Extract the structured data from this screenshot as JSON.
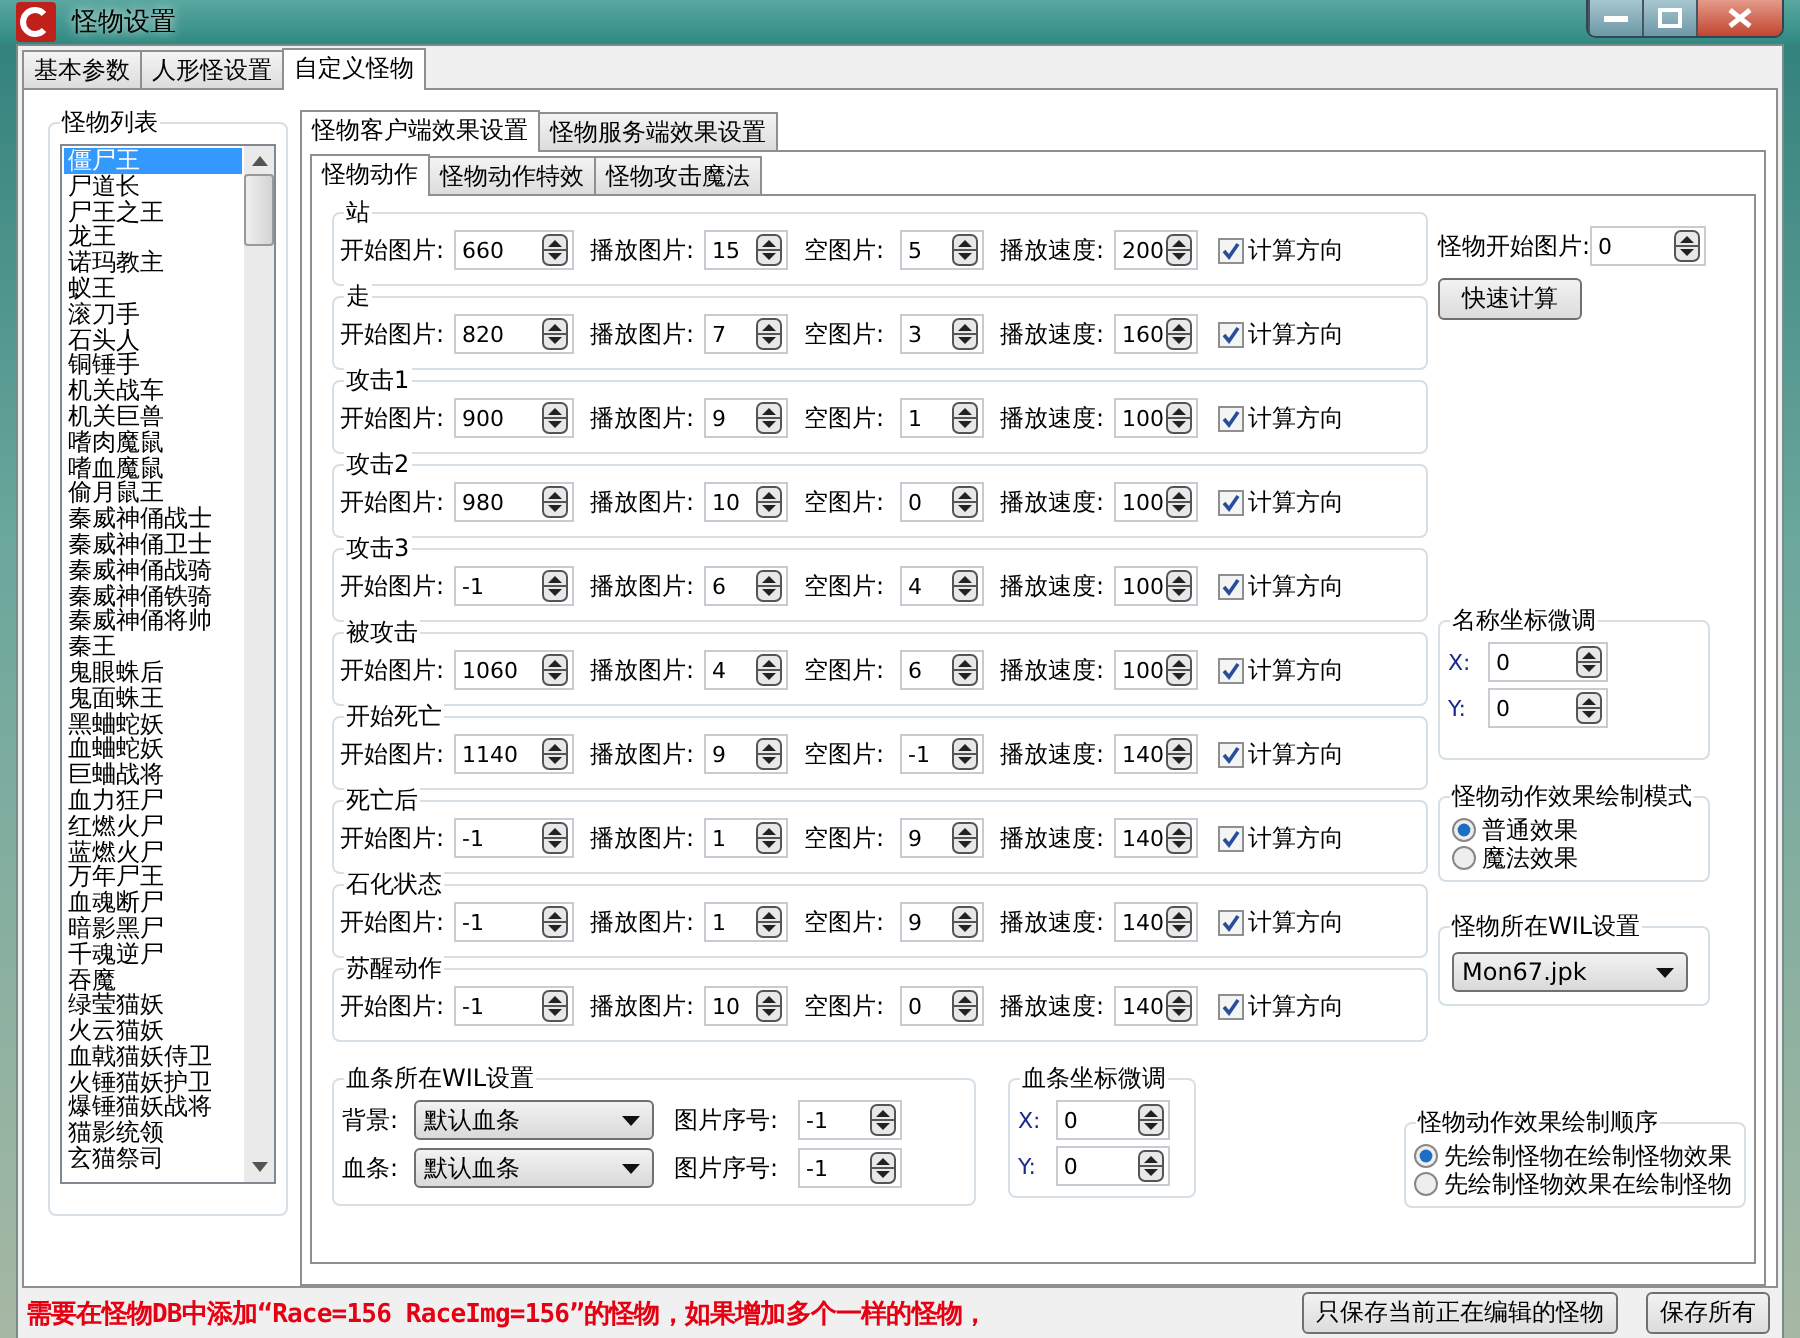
{
  "window": {
    "title": "怪物设置"
  },
  "tabs": [
    {
      "label": "基本参数",
      "selected": false
    },
    {
      "label": "人形怪设置",
      "selected": false
    },
    {
      "label": "自定义怪物",
      "selected": true
    }
  ],
  "monster_list": {
    "title": "怪物列表",
    "items": [
      {
        "label": "僵尸王",
        "selected": true
      },
      {
        "label": "尸道长",
        "selected": false
      },
      {
        "label": "尸王之王",
        "selected": false
      },
      {
        "label": "龙王",
        "selected": false
      },
      {
        "label": "诺玛教主",
        "selected": false
      },
      {
        "label": "蚁王",
        "selected": false
      },
      {
        "label": "滚刀手",
        "selected": false
      },
      {
        "label": "石头人",
        "selected": false
      },
      {
        "label": "铜锤手",
        "selected": false
      },
      {
        "label": "机关战车",
        "selected": false
      },
      {
        "label": "机关巨兽",
        "selected": false
      },
      {
        "label": "嗜肉魔鼠",
        "selected": false
      },
      {
        "label": "嗜血魔鼠",
        "selected": false
      },
      {
        "label": "偷月鼠王",
        "selected": false
      },
      {
        "label": "秦威神俑战士",
        "selected": false
      },
      {
        "label": "秦威神俑卫士",
        "selected": false
      },
      {
        "label": "秦威神俑战骑",
        "selected": false
      },
      {
        "label": "秦威神俑铁骑",
        "selected": false
      },
      {
        "label": "秦威神俑将帅",
        "selected": false
      },
      {
        "label": "秦王",
        "selected": false
      },
      {
        "label": "鬼眼蛛后",
        "selected": false
      },
      {
        "label": "鬼面蛛王",
        "selected": false
      },
      {
        "label": "黑蛐蛇妖",
        "selected": false
      },
      {
        "label": "血蛐蛇妖",
        "selected": false
      },
      {
        "label": "巨蛐战将",
        "selected": false
      },
      {
        "label": "血力狂尸",
        "selected": false
      },
      {
        "label": "红燃火尸",
        "selected": false
      },
      {
        "label": "蓝燃火尸",
        "selected": false
      },
      {
        "label": "万年尸王",
        "selected": false
      },
      {
        "label": "血魂断尸",
        "selected": false
      },
      {
        "label": "暗影黑尸",
        "selected": false
      },
      {
        "label": "千魂逆尸",
        "selected": false
      },
      {
        "label": "吞魔",
        "selected": false
      },
      {
        "label": "绿莹猫妖",
        "selected": false
      },
      {
        "label": "火云猫妖",
        "selected": false
      },
      {
        "label": "血戟猫妖侍卫",
        "selected": false
      },
      {
        "label": "火锤猫妖护卫",
        "selected": false
      },
      {
        "label": "爆锤猫妖战将",
        "selected": false
      },
      {
        "label": "猫影统领",
        "selected": false
      },
      {
        "label": "玄猫祭司",
        "selected": false
      }
    ]
  },
  "sub_tabs": [
    {
      "label": "怪物客户端效果设置",
      "selected": true
    },
    {
      "label": "怪物服务端效果设置",
      "selected": false
    }
  ],
  "action_tabs": [
    {
      "label": "怪物动作",
      "selected": true
    },
    {
      "label": "怪物动作特效",
      "selected": false
    },
    {
      "label": "怪物攻击魔法",
      "selected": false
    }
  ],
  "actions": [
    {
      "title": "站",
      "fields": [
        {
          "label": "开始图片:",
          "value": "660"
        },
        {
          "label": "播放图片:",
          "value": "15"
        },
        {
          "label": "空图片:",
          "value": "5"
        },
        {
          "label": "播放速度:",
          "value": "200"
        }
      ],
      "direction": {
        "label": "计算方向",
        "checked": true
      }
    },
    {
      "title": "走",
      "fields": [
        {
          "label": "开始图片:",
          "value": "820"
        },
        {
          "label": "播放图片:",
          "value": "7"
        },
        {
          "label": "空图片:",
          "value": "3"
        },
        {
          "label": "播放速度:",
          "value": "160"
        }
      ],
      "direction": {
        "label": "计算方向",
        "checked": true
      }
    },
    {
      "title": "攻击1",
      "fields": [
        {
          "label": "开始图片:",
          "value": "900"
        },
        {
          "label": "播放图片:",
          "value": "9"
        },
        {
          "label": "空图片:",
          "value": "1"
        },
        {
          "label": "播放速度:",
          "value": "100"
        }
      ],
      "direction": {
        "label": "计算方向",
        "checked": true
      }
    },
    {
      "title": "攻击2",
      "fields": [
        {
          "label": "开始图片:",
          "value": "980"
        },
        {
          "label": "播放图片:",
          "value": "10"
        },
        {
          "label": "空图片:",
          "value": "0"
        },
        {
          "label": "播放速度:",
          "value": "100"
        }
      ],
      "direction": {
        "label": "计算方向",
        "checked": true
      }
    },
    {
      "title": "攻击3",
      "fields": [
        {
          "label": "开始图片:",
          "value": "-1"
        },
        {
          "label": "播放图片:",
          "value": "6"
        },
        {
          "label": "空图片:",
          "value": "4"
        },
        {
          "label": "播放速度:",
          "value": "100"
        }
      ],
      "direction": {
        "label": "计算方向",
        "checked": true
      }
    },
    {
      "title": "被攻击",
      "fields": [
        {
          "label": "开始图片:",
          "value": "1060"
        },
        {
          "label": "播放图片:",
          "value": "4"
        },
        {
          "label": "空图片:",
          "value": "6"
        },
        {
          "label": "播放速度:",
          "value": "100"
        }
      ],
      "direction": {
        "label": "计算方向",
        "checked": true
      }
    },
    {
      "title": "开始死亡",
      "fields": [
        {
          "label": "开始图片:",
          "value": "1140"
        },
        {
          "label": "播放图片:",
          "value": "9"
        },
        {
          "label": "空图片:",
          "value": "-1"
        },
        {
          "label": "播放速度:",
          "value": "140"
        }
      ],
      "direction": {
        "label": "计算方向",
        "checked": true
      }
    },
    {
      "title": "死亡后",
      "fields": [
        {
          "label": "开始图片:",
          "value": "-1"
        },
        {
          "label": "播放图片:",
          "value": "1"
        },
        {
          "label": "空图片:",
          "value": "9"
        },
        {
          "label": "播放速度:",
          "value": "140"
        }
      ],
      "direction": {
        "label": "计算方向",
        "checked": true
      }
    },
    {
      "title": "石化状态",
      "fields": [
        {
          "label": "开始图片:",
          "value": "-1"
        },
        {
          "label": "播放图片:",
          "value": "1"
        },
        {
          "label": "空图片:",
          "value": "9"
        },
        {
          "label": "播放速度:",
          "value": "140"
        }
      ],
      "direction": {
        "label": "计算方向",
        "checked": true
      }
    },
    {
      "title": "苏醒动作",
      "fields": [
        {
          "label": "开始图片:",
          "value": "-1"
        },
        {
          "label": "播放图片:",
          "value": "10"
        },
        {
          "label": "空图片:",
          "value": "0"
        },
        {
          "label": "播放速度:",
          "value": "140"
        }
      ],
      "direction": {
        "label": "计算方向",
        "checked": true
      }
    }
  ],
  "start_image": {
    "label": "怪物开始图片:",
    "value": "0"
  },
  "quick_calc_button": "快速计算",
  "name_offset": {
    "title": "名称坐标微调",
    "fields": [
      {
        "label": "X:",
        "value": "0"
      },
      {
        "label": "Y:",
        "value": "0"
      }
    ]
  },
  "draw_mode": {
    "title": "怪物动作效果绘制模式",
    "options": [
      {
        "label": "普通效果",
        "selected": true
      },
      {
        "label": "魔法效果",
        "selected": false
      }
    ]
  },
  "monster_wil": {
    "title": "怪物所在WIL设置",
    "value": "Mon67.jpk"
  },
  "hp_bar_wil": {
    "title": "血条所在WIL设置",
    "rows": [
      {
        "label": "背景:",
        "value": "默认血条",
        "index_label": "图片序号:",
        "index": "-1"
      },
      {
        "label": "血条:",
        "value": "默认血条",
        "index_label": "图片序号:",
        "index": "-1"
      }
    ]
  },
  "hp_bar_offset": {
    "title": "血条坐标微调",
    "fields": [
      {
        "label": "X:",
        "value": "0"
      },
      {
        "label": "Y:",
        "value": "0"
      }
    ]
  },
  "draw_order": {
    "title": "怪物动作效果绘制顺序",
    "options": [
      {
        "label": "先绘制怪物在绘制怪物效果",
        "selected": true
      },
      {
        "label": "先绘制怪物效果在绘制怪物",
        "selected": false
      }
    ]
  },
  "notice": "需要在怪物DB中添加“Race=156 RaceImg=156”的怪物，如果增加多个一样的怪物，",
  "buttons": [
    "只保存当前正在编辑的怪物",
    "保存所有"
  ]
}
